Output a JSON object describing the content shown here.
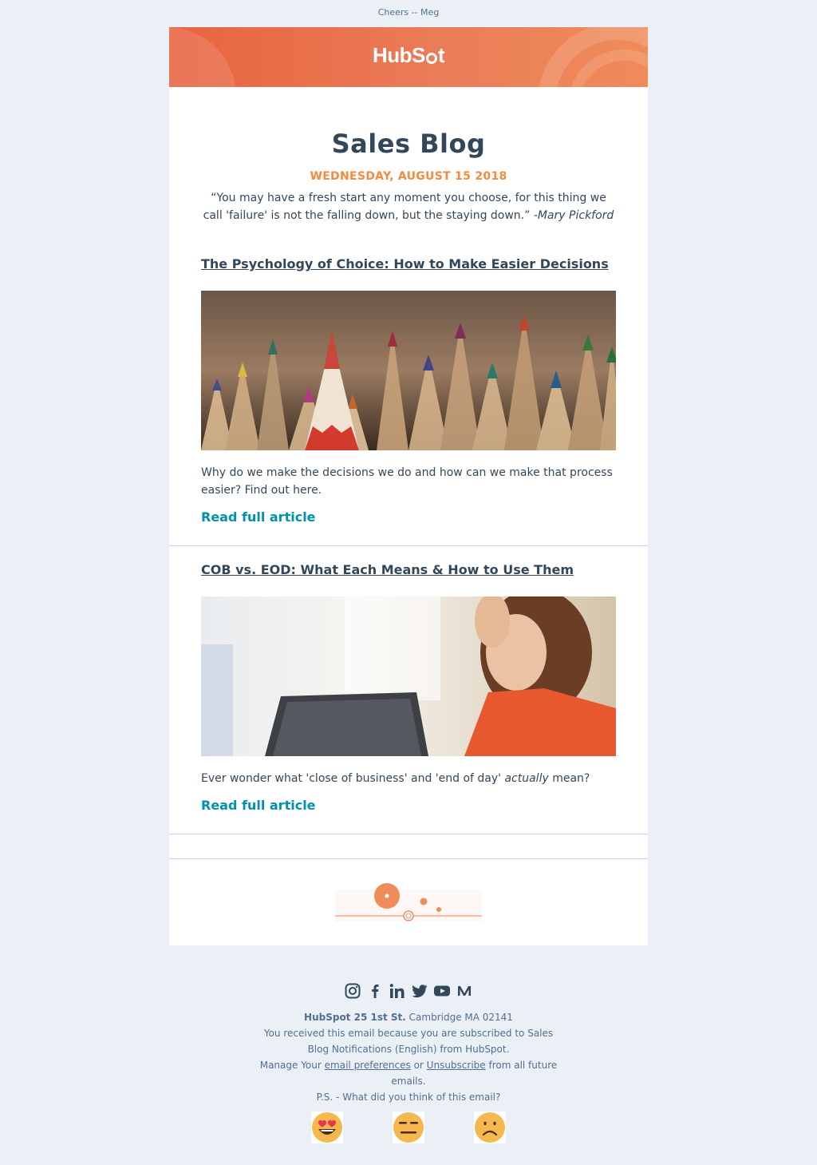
{
  "preheader": "Cheers -- Meg",
  "brand": {
    "logo_text_1": "HubS",
    "logo_text_2": "t",
    "accent": "#ea7c57",
    "date_color": "#f5893c",
    "link_color": "#0091ae"
  },
  "hero": {
    "title": "Sales Blog",
    "date": "WEDNESDAY, AUGUST 15 2018",
    "quote": "“You may have a fresh start any moment you choose, for this thing we call 'failure' is not the falling down, but the staying down.”",
    "quote_author": "-Mary Pickford"
  },
  "articles": [
    {
      "title": "The Psychology of Choice: How to Make Easier Decisions",
      "image": "colored-pencils-photo",
      "summary": "Why do we make the decisions we do and how can we make that process easier? Find out here.",
      "cta": "Read full article"
    },
    {
      "title": "COB vs. EOD: What Each Means & How to Use Them",
      "image": "stressed-woman-laptop-photo",
      "summary_pre": "Ever wonder what 'close of business' and 'end of day'",
      "summary_em": "actually",
      "summary_post": "mean?",
      "cta": "Read full article"
    }
  ],
  "footer": {
    "social_icons": [
      "instagram-icon",
      "facebook-icon",
      "linkedin-icon",
      "twitter-icon",
      "youtube-icon",
      "medium-icon"
    ],
    "company": "HubSpot 25 1st St.",
    "address": "Cambridge MA 02141",
    "subscribed_text": "You received this email because you are subscribed to Sales Blog Notifications (English) from HubSpot.",
    "manage_prefix": "Manage Your",
    "email_prefs": "email preferences",
    "or": "or",
    "unsubscribe": "Unsubscribe",
    "manage_suffix": "from all future emails.",
    "ps": "P.S. - What did you think of this email?",
    "feedback": [
      "love-eyes-emoji",
      "neutral-emoji",
      "sad-emoji"
    ]
  }
}
